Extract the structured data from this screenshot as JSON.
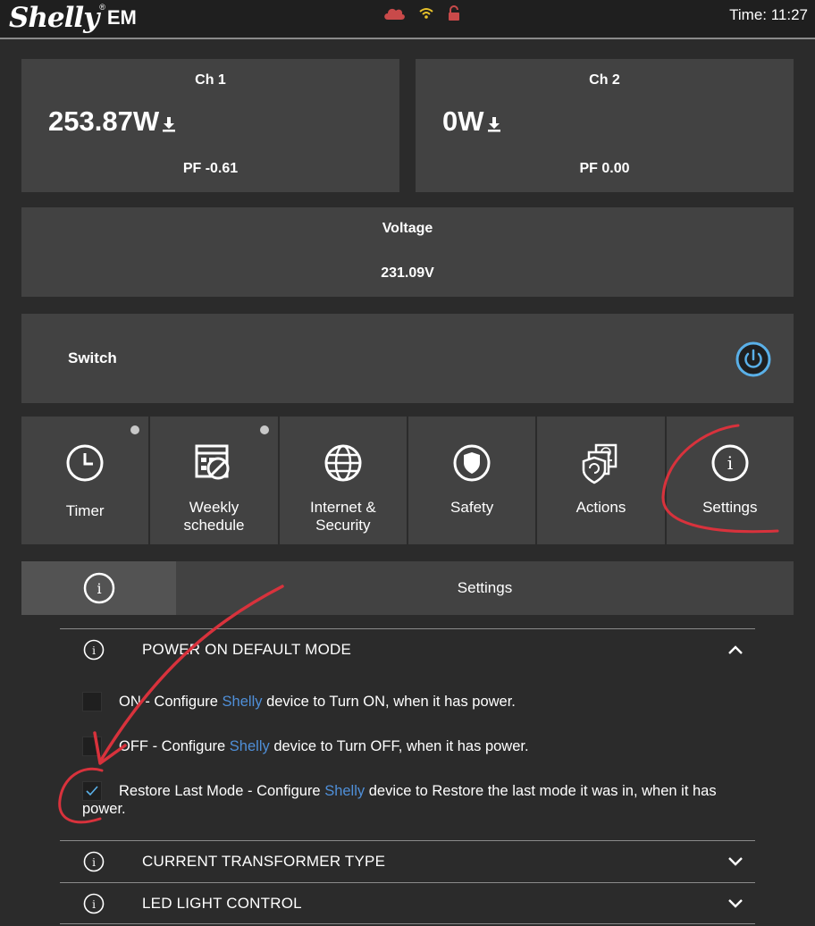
{
  "header": {
    "logo_script": "Shelly",
    "logo_reg": "®",
    "logo_model": "EM",
    "time": "Time: 11:27",
    "icons": [
      "cloud-icon",
      "wifi-icon",
      "unlock-icon"
    ]
  },
  "channels": [
    {
      "title": "Ch 1",
      "value": "253.87W",
      "pf": "PF -0.61"
    },
    {
      "title": "Ch 2",
      "value": "0W",
      "pf": "PF 0.00"
    }
  ],
  "voltage": {
    "title": "Voltage",
    "value": "231.09V"
  },
  "switch": {
    "label": "Switch"
  },
  "tiles": [
    {
      "label": "Timer",
      "icon": "clock-icon",
      "dot": true
    },
    {
      "label": "Weekly schedule",
      "label1": "Weekly",
      "label2": "schedule",
      "icon": "calendar-icon",
      "dot": true
    },
    {
      "label": "Internet & Security",
      "label1": "Internet &",
      "label2": "Security",
      "icon": "globe-icon",
      "dot": false
    },
    {
      "label": "Safety",
      "icon": "shield-icon",
      "dot": false
    },
    {
      "label": "Actions",
      "icon": "actions-icon",
      "dot": false
    },
    {
      "label": "Settings",
      "icon": "info-icon",
      "dot": false
    }
  ],
  "settings": {
    "title": "Settings",
    "sections": [
      {
        "title": "POWER ON DEFAULT MODE",
        "expanded": true,
        "options": [
          {
            "prefix": "ON - Configure ",
            "brand": "Shelly",
            "suffix": " device to Turn ON, when it has power.",
            "checked": false
          },
          {
            "prefix": "OFF - Configure ",
            "brand": "Shelly",
            "suffix": " device to Turn OFF, when it has power.",
            "checked": false
          },
          {
            "prefix": "Restore Last Mode - Configure ",
            "brand": "Shelly",
            "suffix": " device to Restore the last mode it was in, when it has power.",
            "checked": true
          }
        ]
      },
      {
        "title": "CURRENT TRANSFORMER TYPE",
        "expanded": false
      },
      {
        "title": "LED LIGHT CONTROL",
        "expanded": false
      }
    ]
  },
  "colors": {
    "background": "#2b2b2b",
    "panel": "#424242",
    "accent_blue": "#4f8fd8",
    "power_ring": "#5ab0e8",
    "annotation_red": "#d8323c"
  }
}
